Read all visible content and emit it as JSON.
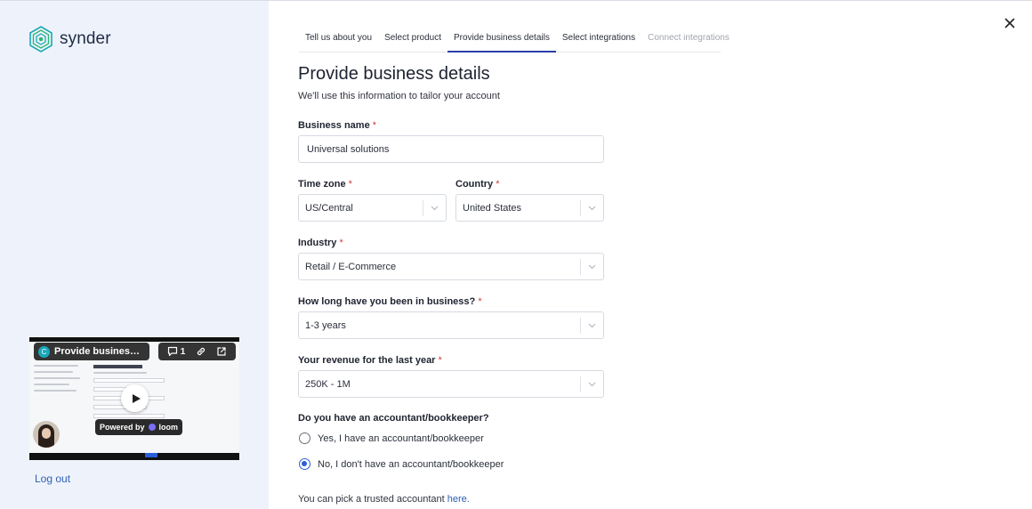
{
  "brand": {
    "name": "synder",
    "icon": "synder-hexagon-logo-icon",
    "accent": "#1aa9b3"
  },
  "video": {
    "title": "Provide business d...",
    "avatar_letter": "C",
    "comment_count": "1",
    "powered_by": "Powered by",
    "powered_brand": "loom"
  },
  "sidebar": {
    "logout_label": "Log out"
  },
  "steps": [
    {
      "label": "Tell us about you",
      "state": "done"
    },
    {
      "label": "Select product",
      "state": "done"
    },
    {
      "label": "Provide business details",
      "state": "active"
    },
    {
      "label": "Select integrations",
      "state": "upcoming"
    },
    {
      "label": "Connect integrations",
      "state": "disabled"
    }
  ],
  "page": {
    "title": "Provide business details",
    "subtitle": "We'll use this information to tailor your account"
  },
  "form": {
    "required_mark": "*",
    "business_name": {
      "label": "Business name",
      "value": "Universal solutions"
    },
    "time_zone": {
      "label": "Time zone",
      "value": "US/Central"
    },
    "country": {
      "label": "Country",
      "value": "United States"
    },
    "industry": {
      "label": "Industry",
      "value": "Retail / E-Commerce"
    },
    "business_age": {
      "label": "How long have you been in business?",
      "value": "1-3 years"
    },
    "revenue": {
      "label": "Your revenue for the last year",
      "value": "250K - 1M"
    },
    "accountant": {
      "question": "Do you have an accountant/bookkeeper?",
      "options": [
        {
          "label": "Yes, I have an accountant/bookkeeper",
          "selected": false
        },
        {
          "label": "No, I don't have an accountant/bookkeeper",
          "selected": true
        }
      ]
    },
    "footnote": {
      "text": "You can pick a trusted accountant ",
      "link": "here."
    }
  },
  "colors": {
    "sidebar_bg": "#eef3fb",
    "primary": "#2b5fd9",
    "step_active": "#2b3fa8",
    "required": "#d03b3b"
  }
}
